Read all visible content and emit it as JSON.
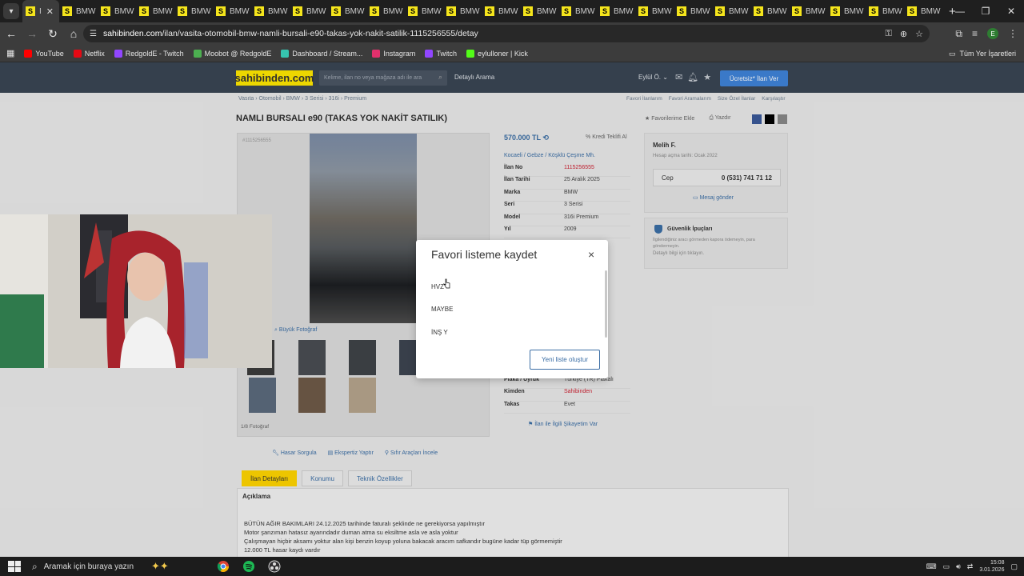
{
  "browser": {
    "tabs": [
      {
        "label": "I",
        "active": true
      },
      {
        "label": "BMW"
      },
      {
        "label": "BMW"
      },
      {
        "label": "BMW"
      },
      {
        "label": "BMW"
      },
      {
        "label": "BMW"
      },
      {
        "label": "BMW"
      },
      {
        "label": "BMW"
      },
      {
        "label": "BMW"
      },
      {
        "label": "BMW"
      },
      {
        "label": "BMW"
      },
      {
        "label": "BMW"
      },
      {
        "label": "BMW"
      },
      {
        "label": "BMW"
      },
      {
        "label": "BMW"
      },
      {
        "label": "BMW"
      },
      {
        "label": "BMW"
      },
      {
        "label": "BMW"
      },
      {
        "label": "BMW"
      },
      {
        "label": "BMW"
      },
      {
        "label": "BMW"
      },
      {
        "label": "BMW"
      },
      {
        "label": "BMW"
      },
      {
        "label": "BMW"
      }
    ],
    "tab_favicon_letter": "S",
    "new_tab": "+",
    "url_host": "sahibinden.com",
    "url_path": "/ilan/vasita-otomobil-bmw-namli-bursali-e90-takas-yok-nakit-satilik-1115256555/detay",
    "profile_initial": "E",
    "bookmarks": [
      {
        "label": "YouTube",
        "color": "#ff0000"
      },
      {
        "label": "Netflix",
        "color": "#e50914"
      },
      {
        "label": "RedgoldE - Twitch",
        "color": "#9146ff"
      },
      {
        "label": "Moobot @ RedgoldE",
        "color": "#4caf50"
      },
      {
        "label": "Dashboard / Stream...",
        "color": "#36c5b0"
      },
      {
        "label": "Instagram",
        "color": "#e1306c"
      },
      {
        "label": "Twitch",
        "color": "#9146ff"
      },
      {
        "label": "eylulloner | Kick",
        "color": "#53fc18"
      }
    ],
    "bookmarks_all": "Tüm Yer İşaretleri"
  },
  "site": {
    "logo": "sahibinden.com",
    "search_placeholder": "Kelime, ilan no veya mağaza adı ile ara",
    "detailed_search": "Detaylı Arama",
    "user": "Eylül Ö.",
    "post_ad": "Ücretsiz* İlan Ver",
    "breadcrumbs": "Vasıta   ›   Otomobil   ›   BMW   ›   3 Serisi   ›   316i   ›   Premium",
    "quick_links": [
      "Favori İlanlarım",
      "Favori Aramalarım",
      "Size Özel İlanlar",
      "Karşılaştır"
    ]
  },
  "listing": {
    "title": "NAMLI BURSALI e90 (TAKAS YOK NAKİT SATILIK)",
    "add_favorite": "Favorilerime Ekle",
    "print": "Yazdır",
    "ad_no_small": "#1115256555",
    "big_photo": "Büyük Fotoğraf",
    "photo_count": "1/8 Fotoğraf",
    "price": "570.000 TL",
    "credit": "Kredi Teklifi Al",
    "location": "Kocaeli  /  Gebze  /  Köşklü Çeşme Mh.",
    "info": [
      {
        "k": "İlan No",
        "v": "1115256555",
        "red": true
      },
      {
        "k": "İlan Tarihi",
        "v": "25 Aralık 2025"
      },
      {
        "k": "Marka",
        "v": "BMW"
      },
      {
        "k": "Seri",
        "v": "3 Serisi"
      },
      {
        "k": "Model",
        "v": "316i Premium"
      },
      {
        "k": "Yıl",
        "v": "2009"
      }
    ],
    "info_bottom": [
      {
        "k": "Plaka / Uyruk",
        "v": "Türkiye (TR) Plakalı"
      },
      {
        "k": "Kimden",
        "v": "Sahibinden",
        "red": true
      },
      {
        "k": "Takas",
        "v": "Evet"
      }
    ],
    "complaint": "İlan ile İlgili Şikayetim Var",
    "tools": [
      "Hasar Sorgula",
      "Ekspertiz Yaptır",
      "Sıfır Araçları İncele"
    ],
    "page_tabs": [
      "İlan Detayları",
      "Konumu",
      "Teknik Özellikler"
    ],
    "description_header": "Açıklama",
    "description_lines": [
      "BÜTÜN AĞIR BAKIMLARI 24.12.2025 tarihinde faturalı şeklinde ne gerekiyorsa yapılmıştır",
      "Motor şanzıman hatasız ayarındadır duman atma su eksiltme asla ve asla yoktur",
      "Çalışmayan hiçbir aksamı yoktur alan kişi benzin koyup yoluna bakacak aracım safkandır bugüne kadar tüp görmemiştir",
      "12.000 TL hasar kaydı vardır"
    ]
  },
  "seller": {
    "name": "Melih F.",
    "since": "Hesap açma tarihi: Ocak 2022",
    "phone_label": "Cep",
    "phone": "0 (531) 741 71 12",
    "message": "Mesaj gönder"
  },
  "safety": {
    "title": "Güvenlik İpuçları",
    "desc": "İlgilendiğiniz aracı görmeden kapora ödemeyin, para göndermeyin.",
    "link": "Detaylı bilgi için tıklayın."
  },
  "modal": {
    "title": "Favori listeme kaydet",
    "close": "×",
    "lists": [
      "HVZ",
      "MAYBE",
      "İNŞ Y"
    ],
    "new_list": "Yeni liste oluştur"
  },
  "taskbar": {
    "search": "Aramak için buraya yazın",
    "time": "15:08",
    "date": "3.01.2026"
  }
}
